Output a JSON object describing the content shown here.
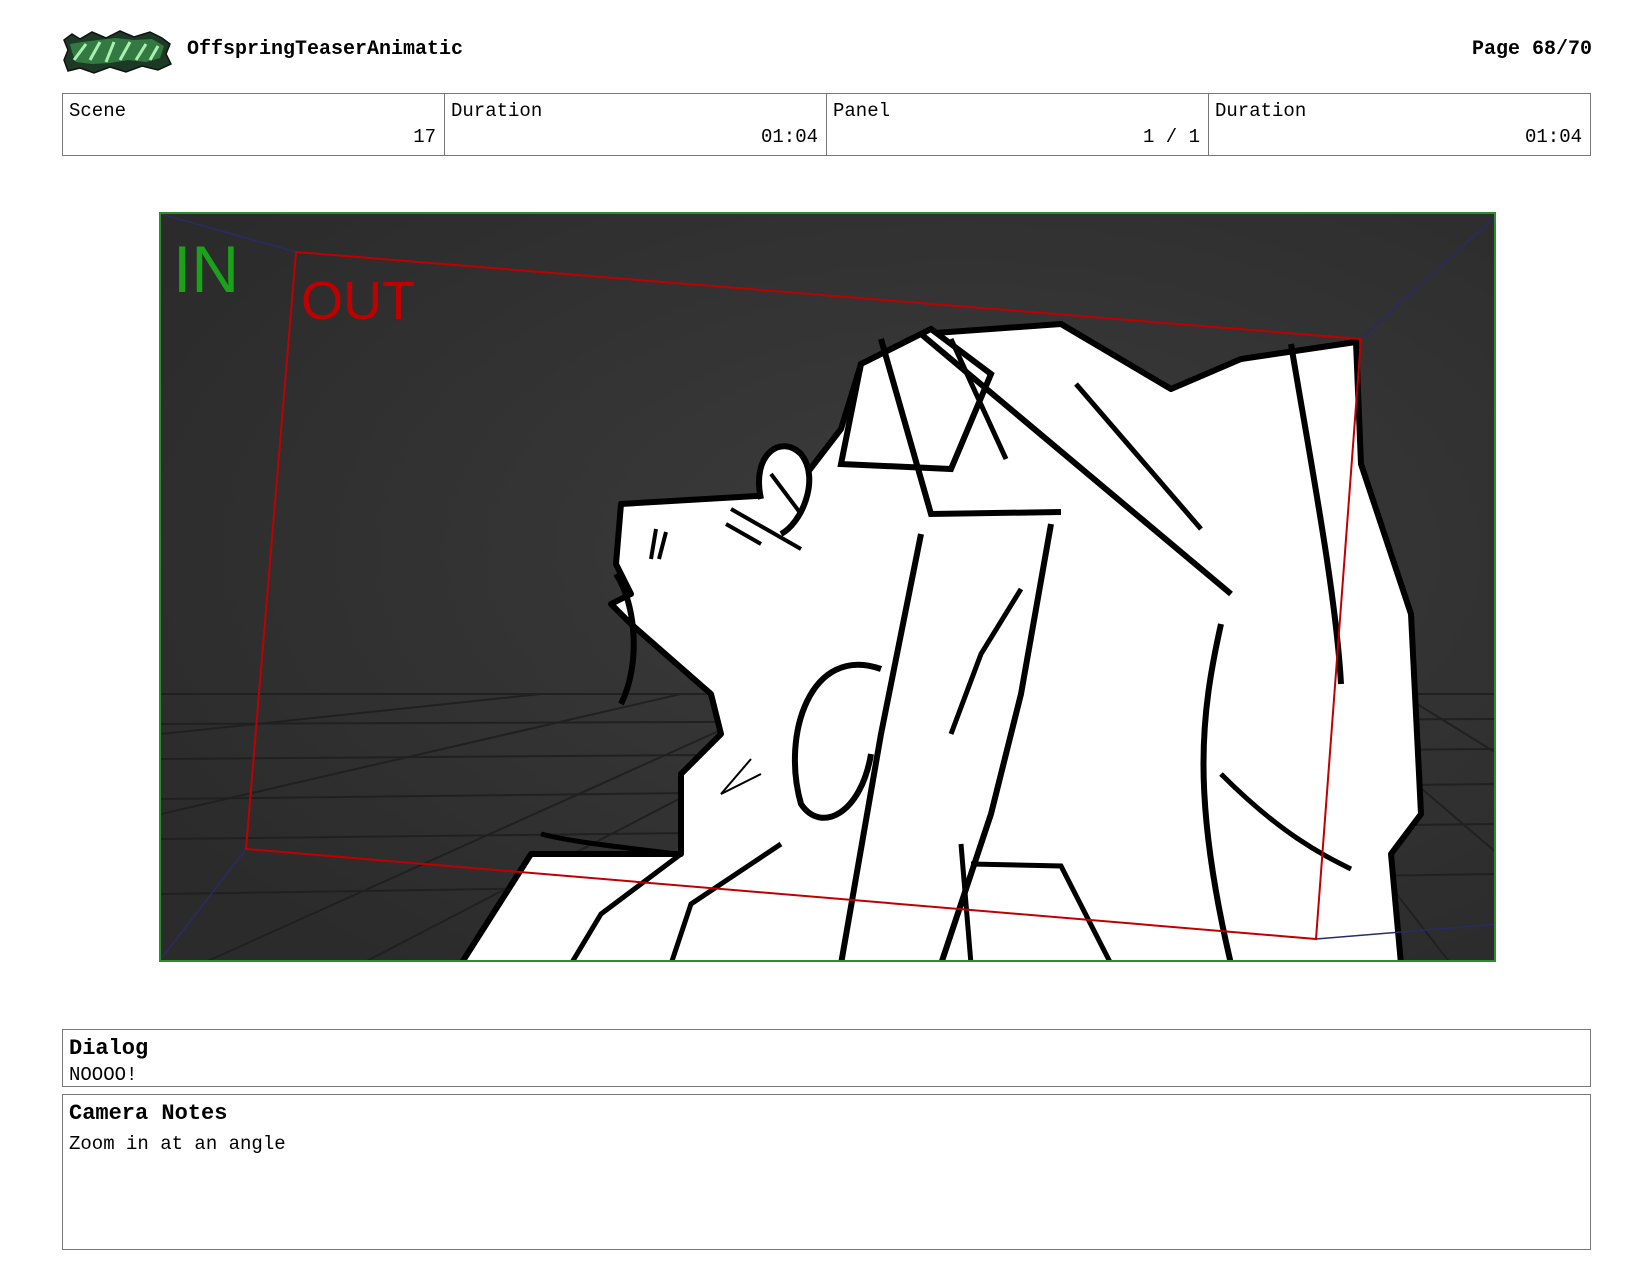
{
  "header": {
    "logo_text": "OFFSPRING",
    "project_title": "OffspringTeaserAnimatic",
    "page": "Page 68/70"
  },
  "info": [
    {
      "label": "Scene",
      "value": "17"
    },
    {
      "label": "Duration",
      "value": "01:04"
    },
    {
      "label": "Panel",
      "value": "1 / 1"
    },
    {
      "label": "Duration",
      "value": "01:04"
    }
  ],
  "panel": {
    "in_label": "IN",
    "out_label": "OUT",
    "colors": {
      "in": "#1aa31a",
      "out": "#c00000",
      "background": "#333333",
      "frame": "#2e8b2e"
    }
  },
  "dialog": {
    "title": "Dialog",
    "text": "NOOOO!"
  },
  "camera_notes": {
    "title": "Camera Notes",
    "text": "Zoom in at an angle"
  }
}
